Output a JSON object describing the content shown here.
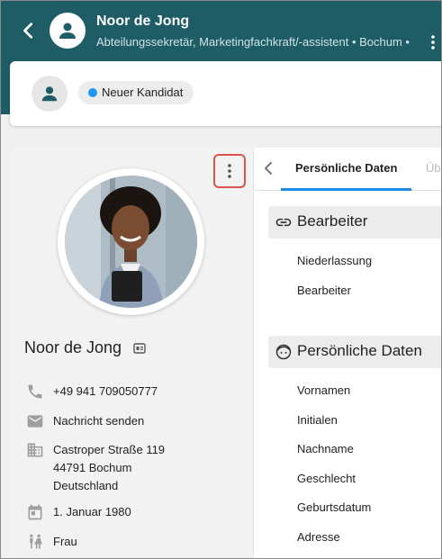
{
  "header": {
    "name": "Noor de Jong",
    "subtitle": "Abteilungssekretär, Marketingfachkraft/-assistent  •  Bochum  •",
    "colors": {
      "appbar": "#1e5d66"
    },
    "icons": {
      "back": "chevron-left-icon",
      "avatar": "person-icon",
      "more": "more-vertical-icon"
    }
  },
  "status": {
    "label": "Neuer Kandidat",
    "dot_color": "#2196f3"
  },
  "profile": {
    "name": "Noor de Jong",
    "phone": "+49 941 709050777",
    "message": "Nachricht senden",
    "address_line1": "Castroper Straße 119",
    "address_line2": "44791 Bochum",
    "address_line3": "Deutschland",
    "birthdate": "1. Januar 1980",
    "gender": "Frau",
    "link_color": "#1e88e5"
  },
  "tabs": {
    "active": "Persönliche Daten",
    "next": "Üb"
  },
  "sections": [
    {
      "title": "Bearbeiter",
      "icon": "link-icon",
      "fields": [
        "Niederlassung",
        "Bearbeiter"
      ]
    },
    {
      "title": "Persönliche Daten",
      "icon": "face-icon",
      "fields": [
        "Vornamen",
        "Initialen",
        "Nachname",
        "Geschlecht",
        "Geburtsdatum",
        "Adresse"
      ]
    }
  ]
}
